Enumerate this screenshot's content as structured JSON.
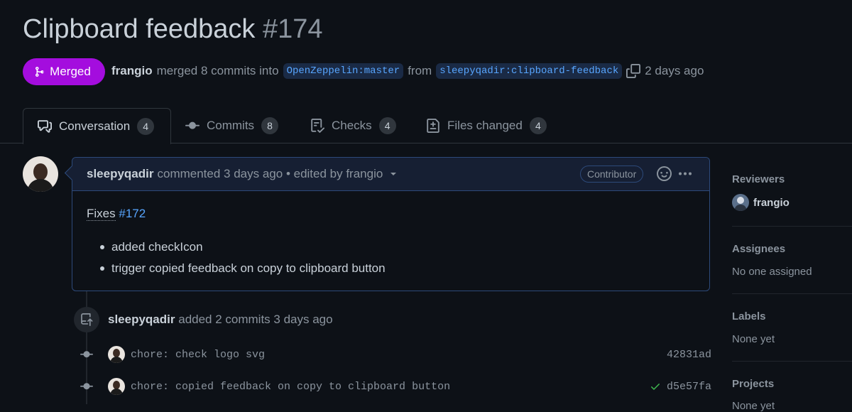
{
  "pr": {
    "title": "Clipboard feedback",
    "number": "#174",
    "state_label": "Merged",
    "author": "frangio",
    "merge_text": "merged 8 commits into",
    "base_branch": "OpenZeppelin:master",
    "from_text": "from",
    "head_branch": "sleepyqadir:clipboard-feedback",
    "time_ago": "2 days ago"
  },
  "tabs": [
    {
      "label": "Conversation",
      "count": "4",
      "icon": "comment-discussion-icon"
    },
    {
      "label": "Commits",
      "count": "8",
      "icon": "git-commit-icon"
    },
    {
      "label": "Checks",
      "count": "4",
      "icon": "checklist-icon"
    },
    {
      "label": "Files changed",
      "count": "4",
      "icon": "file-diff-icon"
    }
  ],
  "comment": {
    "author": "sleepyqadir",
    "meta": "commented 3 days ago • edited by frangio",
    "role_badge": "Contributor",
    "fixes_label": "Fixes",
    "fixes_link": "#172",
    "bullets": [
      "added checkIcon",
      "trigger copied feedback on copy to clipboard button"
    ]
  },
  "timeline": {
    "event_author": "sleepyqadir",
    "event_text": "added 2 commits 3 days ago",
    "commits": [
      {
        "message": "chore: check logo svg",
        "sha": "42831ad",
        "status": ""
      },
      {
        "message": "chore: copied feedback on copy to clipboard button",
        "sha": "d5e57fa",
        "status": "success"
      }
    ]
  },
  "sidebar": {
    "reviewers_title": "Reviewers",
    "reviewer": "frangio",
    "assignees_title": "Assignees",
    "assignees_value": "No one assigned",
    "labels_title": "Labels",
    "labels_value": "None yet",
    "projects_title": "Projects",
    "projects_value": "None yet"
  },
  "colors": {
    "background": "#0d1117",
    "merged": "#a40dde",
    "link": "#58a6ff",
    "success": "#3fb950"
  }
}
